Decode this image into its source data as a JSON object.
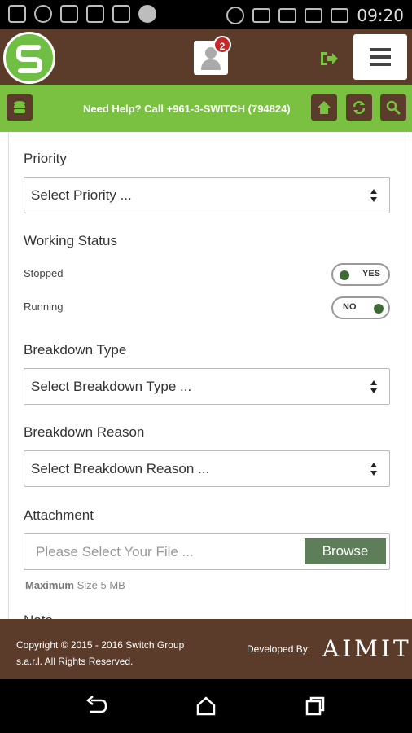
{
  "status_bar": {
    "time": "09:20"
  },
  "header": {
    "notification_count": "2"
  },
  "greenbar": {
    "help_text": "Need Help? Call +961-3-SWITCH (794824)"
  },
  "form": {
    "priority": {
      "label": "Priority",
      "value": "Select Priority ..."
    },
    "working_status": {
      "label": "Working Status",
      "stopped": {
        "label": "Stopped",
        "toggle": "YES"
      },
      "running": {
        "label": "Running",
        "toggle": "NO"
      }
    },
    "breakdown_type": {
      "label": "Breakdown Type",
      "value": "Select Breakdown Type ..."
    },
    "breakdown_reason": {
      "label": "Breakdown Reason",
      "value": "Select Breakdown Reason ..."
    },
    "attachment": {
      "label": "Attachment",
      "placeholder": "Please Select Your File ...",
      "browse_label": "Browse",
      "max_bold": "Maximum",
      "max_rest": " Size 5 MB"
    },
    "note_label": "Note"
  },
  "footer": {
    "copyright": "Copyright © 2015 - 2016 Switch Group s.a.r.l. All Rights Reserved.",
    "developed_by": "Developed By:",
    "developer": "AIMIT"
  },
  "colors": {
    "brown": "#5b3b29",
    "green": "#7ac142",
    "browse_green": "#5e7e5a"
  }
}
